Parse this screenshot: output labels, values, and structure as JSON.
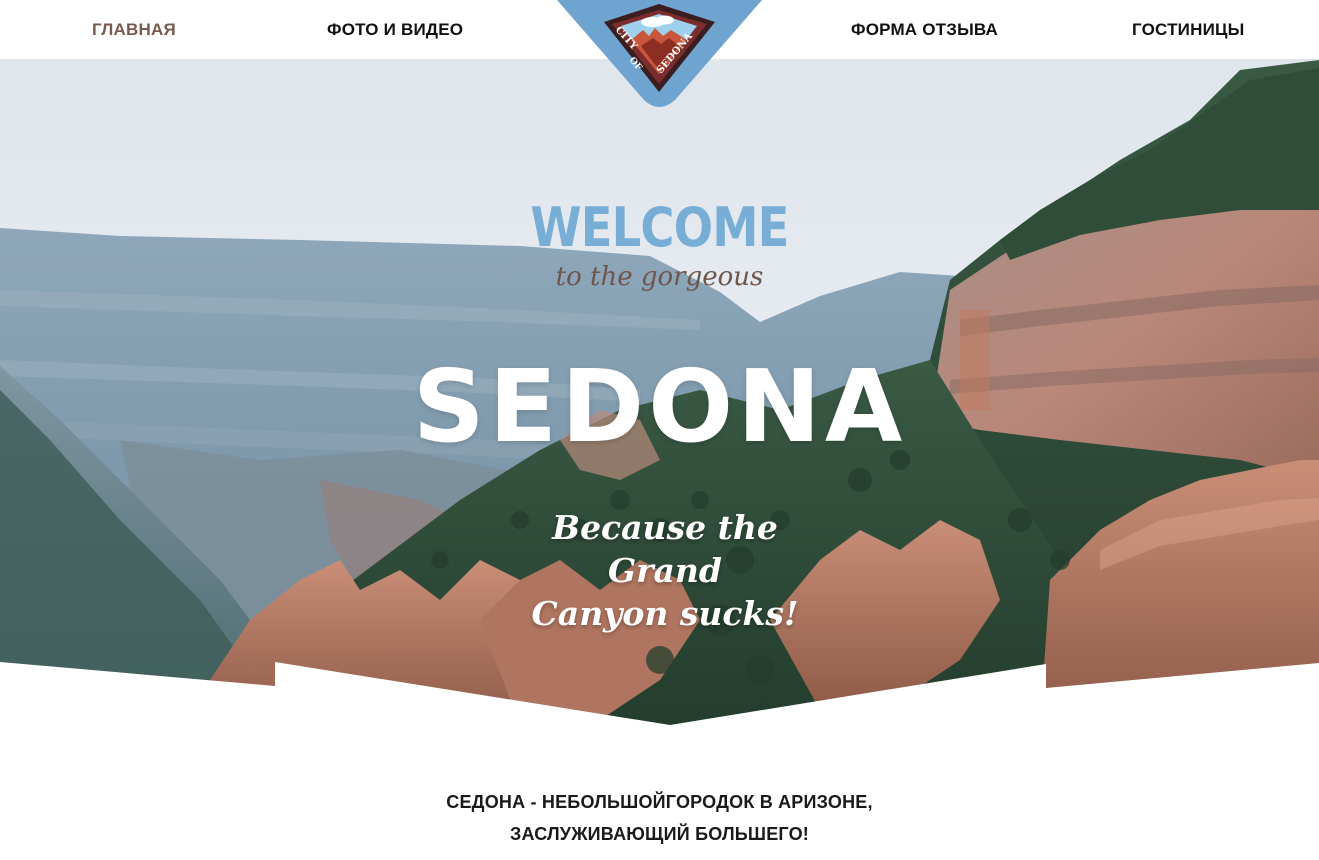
{
  "nav": {
    "items": [
      {
        "label": "ГЛАВНАЯ",
        "active": true
      },
      {
        "label": "ФОТО И ВИДЕО",
        "active": false
      },
      {
        "label": "ФОРМА ОТЗЫВА",
        "active": false
      },
      {
        "label": "ГОСТИНИЦЫ",
        "active": false
      }
    ],
    "active_color": "#7a5a4e"
  },
  "logo": {
    "icon": "city-of-sedona-logo",
    "text": "CITY OF SEDONA"
  },
  "hero": {
    "welcome": "WELCOME",
    "subtitle": "to the gorgeous",
    "title": "SEDONA",
    "tagline_line1": "Because the Grand",
    "tagline_line2": "Canyon sucks!"
  },
  "intro": {
    "line1": "СЕДОНА - НЕБОЛЬШОЙГОРОДОК В АРИЗОНЕ,",
    "line2": "ЗАСЛУЖИВАЮЩИЙ БОЛЬШЕГО!"
  },
  "colors": {
    "accent_blue": "#78aed6",
    "logo_blue": "#6fa3d0",
    "brown": "#6e564c",
    "rock_red": "#b0634d"
  }
}
